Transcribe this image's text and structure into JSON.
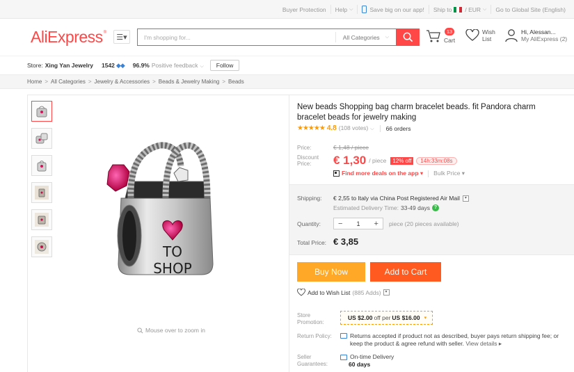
{
  "topbar": {
    "buyer_protection": "Buyer Protection",
    "help": "Help",
    "app_promo": "Save big on our app!",
    "ship_to": "Ship to",
    "currency": "/ EUR",
    "global_site": "Go to Global Site (English)"
  },
  "header": {
    "logo": "AliExpress",
    "search_placeholder": "I'm shopping for...",
    "search_category": "All Categories",
    "cart_count": "13",
    "cart_label": "Cart",
    "wish_line1": "Wish",
    "wish_line2": "List",
    "account_line1": "Hi, Alessan...",
    "account_line2": "My AliExpress (2)"
  },
  "store": {
    "label": "Store:",
    "name": "Xing Yan Jewelry",
    "score": "1542",
    "positive_pct": "96.9%",
    "feedback_label": "Positive feedback",
    "follow_label": "Follow"
  },
  "breadcrumb": [
    "Home",
    "All Categories",
    "Jewelry & Accessories",
    "Beads & Jewelry Making",
    "Beads"
  ],
  "gallery": {
    "thumb_count": 6,
    "zoom_hint": "Mouse over to zoom in",
    "product_text_line1": "TO",
    "product_text_line2": "SHOP"
  },
  "product": {
    "title": "New beads Shopping bag charm bracelet beads. fit Pandora charm bracelet beads for jewelry making",
    "stars": "★★★★★",
    "rating": "4.8",
    "votes": "(108 votes)",
    "orders": "66 orders",
    "price_label": "Price:",
    "old_price": "€ 1,48 / piece",
    "discount_label_1": "Discount",
    "discount_label_2": "Price:",
    "price": "€ 1,30",
    "price_unit": "/ piece",
    "discount_pct": "12% off",
    "timer": "14h:33m:08s",
    "app_deals": "Find more deals on the app",
    "bulk_price": "Bulk Price",
    "shipping_label": "Shipping:",
    "shipping_value": "€ 2,55 to Italy via China Post Registered Air Mail",
    "delivery_label": "Estimated Delivery Time:",
    "delivery_value": "33-49 days",
    "quantity_label": "Quantity:",
    "quantity_value": "1",
    "quantity_note": "piece (20 pieces available)",
    "total_label": "Total Price:",
    "total_value": "€ 3,85",
    "buy_now": "Buy Now",
    "add_to_cart": "Add to Cart",
    "add_wishlist": "Add to Wish List",
    "wishlist_count": "(885 Adds)",
    "promo_label_1": "Store",
    "promo_label_2": "Promotion:",
    "promo_amount": "US $2.00",
    "promo_mid": "off per",
    "promo_threshold": "US $16.00",
    "return_label": "Return Policy:",
    "return_text": "Returns accepted if product not as described, buyer pays return shipping fee; or keep the product & agree refund with seller.",
    "view_details": "View details ▸",
    "guarantee_label_1": "Seller",
    "guarantee_label_2": "Guarantees:",
    "guarantee_name": "On-time Delivery",
    "guarantee_days": "60 days"
  },
  "colors": {
    "brand": "#ff4747",
    "buy_now": "#ffa726",
    "add_cart": "#ff5a1f"
  }
}
